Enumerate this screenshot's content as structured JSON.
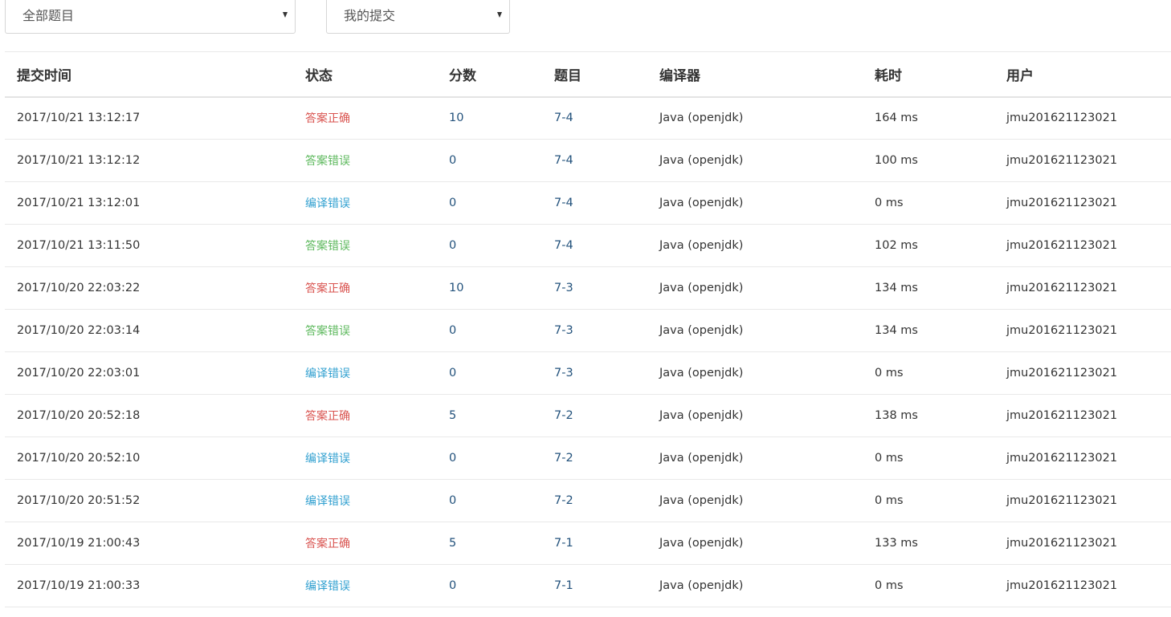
{
  "filters": {
    "problem": {
      "value": "全部题目"
    },
    "scope": {
      "value": "我的提交"
    }
  },
  "table": {
    "headers": [
      "提交时间",
      "状态",
      "分数",
      "题目",
      "编译器",
      "耗时",
      "用户"
    ],
    "rows": [
      {
        "time": "2017/10/21 13:12:17",
        "status": "答案正确",
        "status_type": "ok",
        "score": "10",
        "problem": "7-4",
        "compiler": "Java (openjdk)",
        "elapsed": "164 ms",
        "user": "jmu201621123021"
      },
      {
        "time": "2017/10/21 13:12:12",
        "status": "答案错误",
        "status_type": "wa",
        "score": "0",
        "problem": "7-4",
        "compiler": "Java (openjdk)",
        "elapsed": "100 ms",
        "user": "jmu201621123021"
      },
      {
        "time": "2017/10/21 13:12:01",
        "status": "编译错误",
        "status_type": "ce",
        "score": "0",
        "problem": "7-4",
        "compiler": "Java (openjdk)",
        "elapsed": "0 ms",
        "user": "jmu201621123021"
      },
      {
        "time": "2017/10/21 13:11:50",
        "status": "答案错误",
        "status_type": "wa",
        "score": "0",
        "problem": "7-4",
        "compiler": "Java (openjdk)",
        "elapsed": "102 ms",
        "user": "jmu201621123021"
      },
      {
        "time": "2017/10/20 22:03:22",
        "status": "答案正确",
        "status_type": "ok",
        "score": "10",
        "problem": "7-3",
        "compiler": "Java (openjdk)",
        "elapsed": "134 ms",
        "user": "jmu201621123021"
      },
      {
        "time": "2017/10/20 22:03:14",
        "status": "答案错误",
        "status_type": "wa",
        "score": "0",
        "problem": "7-3",
        "compiler": "Java (openjdk)",
        "elapsed": "134 ms",
        "user": "jmu201621123021"
      },
      {
        "time": "2017/10/20 22:03:01",
        "status": "编译错误",
        "status_type": "ce",
        "score": "0",
        "problem": "7-3",
        "compiler": "Java (openjdk)",
        "elapsed": "0 ms",
        "user": "jmu201621123021"
      },
      {
        "time": "2017/10/20 20:52:18",
        "status": "答案正确",
        "status_type": "ok",
        "score": "5",
        "problem": "7-2",
        "compiler": "Java (openjdk)",
        "elapsed": "138 ms",
        "user": "jmu201621123021"
      },
      {
        "time": "2017/10/20 20:52:10",
        "status": "编译错误",
        "status_type": "ce",
        "score": "0",
        "problem": "7-2",
        "compiler": "Java (openjdk)",
        "elapsed": "0 ms",
        "user": "jmu201621123021"
      },
      {
        "time": "2017/10/20 20:51:52",
        "status": "编译错误",
        "status_type": "ce",
        "score": "0",
        "problem": "7-2",
        "compiler": "Java (openjdk)",
        "elapsed": "0 ms",
        "user": "jmu201621123021"
      },
      {
        "time": "2017/10/19 21:00:43",
        "status": "答案正确",
        "status_type": "ok",
        "score": "5",
        "problem": "7-1",
        "compiler": "Java (openjdk)",
        "elapsed": "133 ms",
        "user": "jmu201621123021"
      },
      {
        "time": "2017/10/19 21:00:33",
        "status": "编译错误",
        "status_type": "ce",
        "score": "0",
        "problem": "7-1",
        "compiler": "Java (openjdk)",
        "elapsed": "0 ms",
        "user": "jmu201621123021"
      }
    ]
  },
  "colors": {
    "accepted": "#d9534f",
    "wrong_answer": "#5cb85c",
    "compile_error": "#31a0d0",
    "link": "#23527c",
    "text": "#333333",
    "border": "#e9e9e9"
  },
  "icons": {
    "select_caret": "caret-down-icon"
  }
}
